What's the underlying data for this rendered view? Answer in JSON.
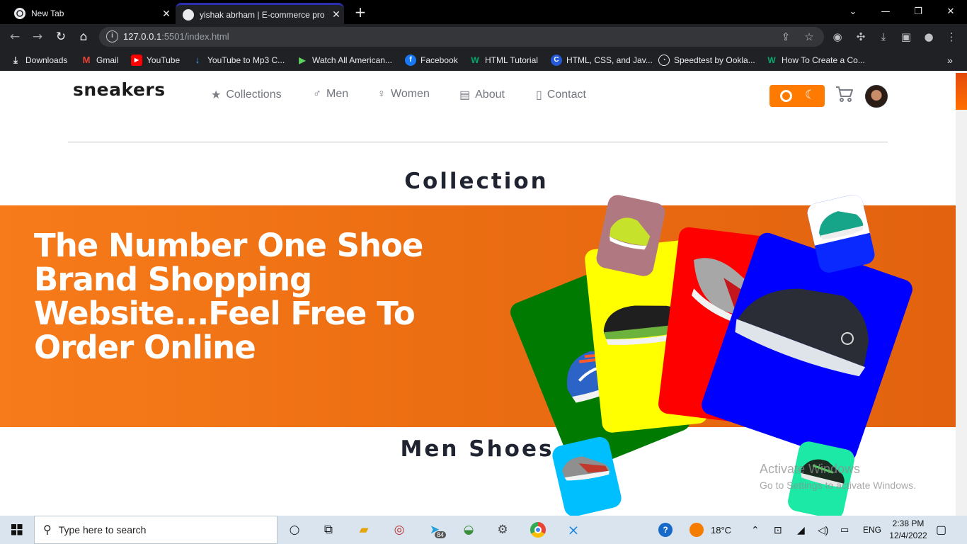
{
  "browser": {
    "tabs": [
      {
        "title": "New Tab",
        "active": false
      },
      {
        "title": "yishak abrham | E-commerce pro",
        "active": true
      }
    ],
    "new_tab_symbol": "+",
    "url_host": "127.0.0.1",
    "url_rest": ":5501/index.html",
    "bookmarks": [
      {
        "label": "Downloads",
        "icon": "download-icon"
      },
      {
        "label": "Gmail",
        "icon": "gmail-icon"
      },
      {
        "label": "YouTube",
        "icon": "youtube-icon"
      },
      {
        "label": "YouTube to Mp3 C...",
        "icon": "converter-icon"
      },
      {
        "label": "Watch All American...",
        "icon": "play-icon"
      },
      {
        "label": "Facebook",
        "icon": "facebook-icon"
      },
      {
        "label": "HTML Tutorial",
        "icon": "w3schools-icon"
      },
      {
        "label": "HTML, CSS, and Jav...",
        "icon": "c-icon"
      },
      {
        "label": "Speedtest by Ookla...",
        "icon": "speedtest-icon"
      },
      {
        "label": "How To Create a Co...",
        "icon": "w3schools-icon"
      }
    ],
    "more_bookmarks": "»"
  },
  "site": {
    "logo": "sneakers",
    "nav": [
      {
        "label": "Collections",
        "icon": "star-icon"
      },
      {
        "label": "Men",
        "icon": "man-icon"
      },
      {
        "label": "Women",
        "icon": "woman-icon"
      },
      {
        "label": "About",
        "icon": "id-card-icon"
      },
      {
        "label": "Contact",
        "icon": "contact-book-icon"
      }
    ],
    "accent_color": "#ff7a00",
    "collection_title": "Collection",
    "hero_text": "The Number One Shoe Brand Shopping Website...Feel Free To Order Online",
    "men_title": "Men Shoes"
  },
  "watermark": {
    "line1": "Activate Windows",
    "line2": "Go to Settings to activate Windows."
  },
  "taskbar": {
    "search_placeholder": "Type here to search",
    "telegram_badge": "84",
    "weather": "18°C",
    "language": "ENG",
    "time": "2:38 PM",
    "date": "12/4/2022"
  }
}
